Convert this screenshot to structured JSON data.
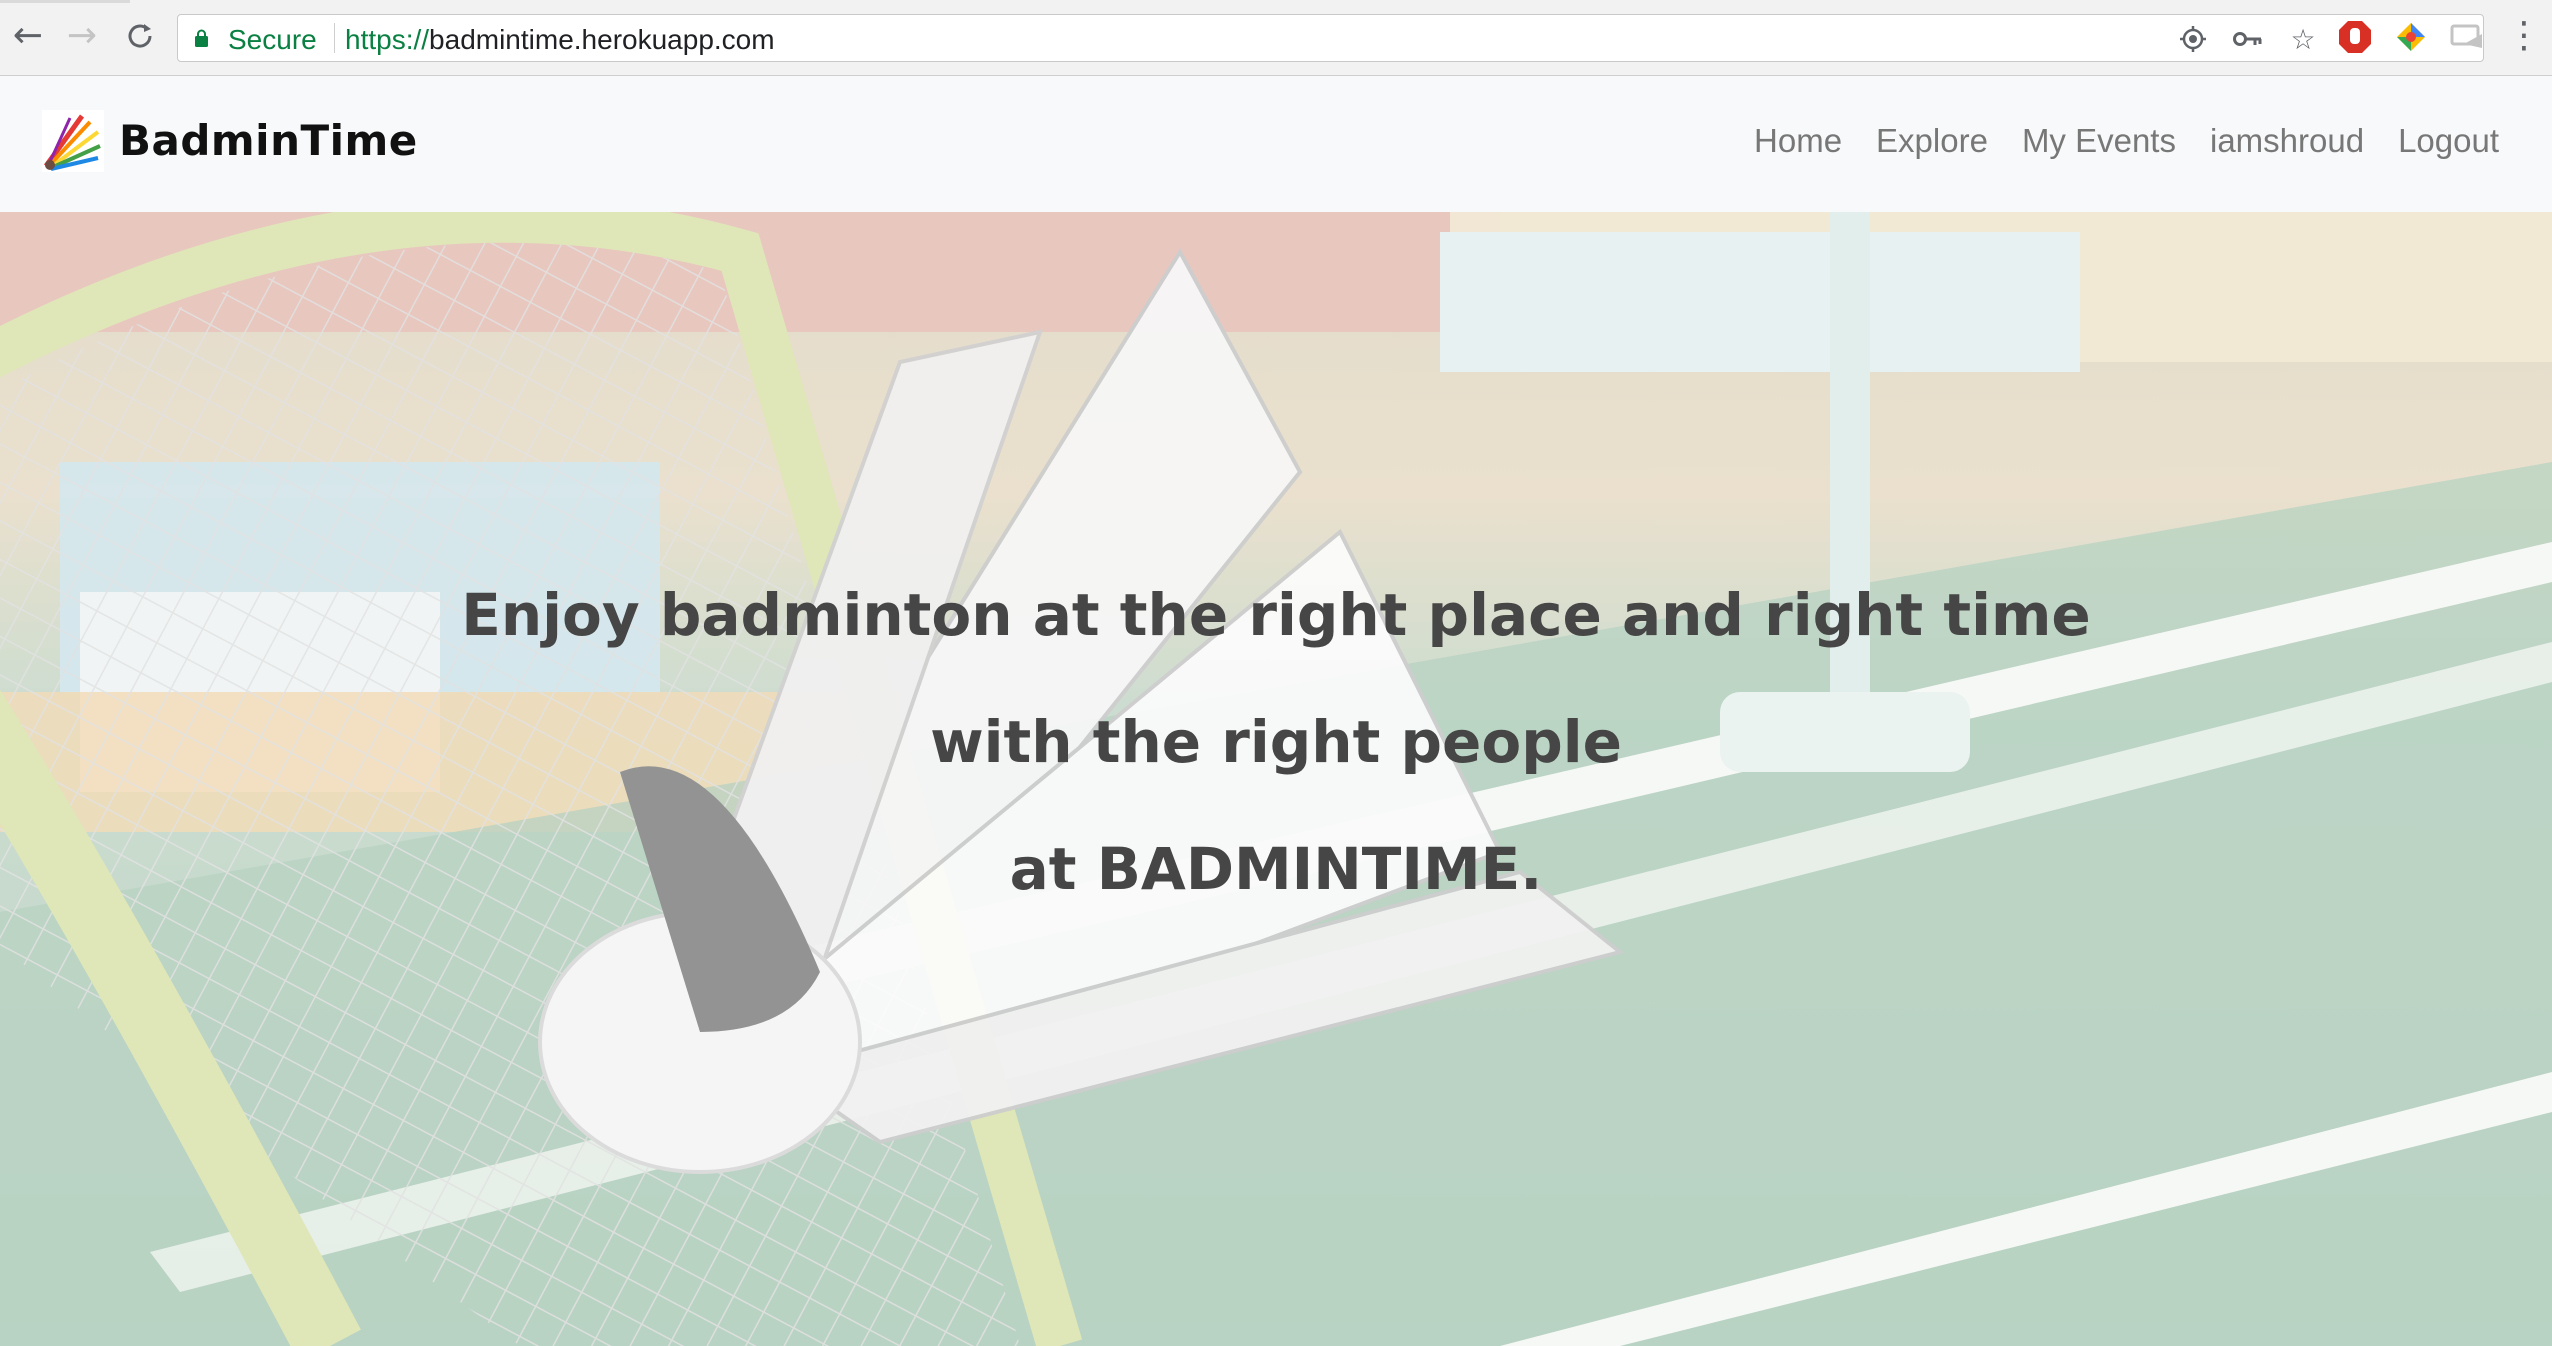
{
  "browser": {
    "secure_label": "Secure",
    "url_scheme": "https://",
    "url_host": "badmintime.herokuapp.com",
    "icons": [
      "back-arrow-icon",
      "forward-arrow-icon",
      "reload-icon",
      "lock-icon",
      "location-icon",
      "key-icon",
      "star-icon",
      "stop-extension-icon",
      "color-extension-icon",
      "cast-extension-icon",
      "more-menu-icon"
    ],
    "colors": {
      "secure_green": "#0b8043"
    }
  },
  "site": {
    "brand": "BadminTime",
    "nav": {
      "home": "Home",
      "explore": "Explore",
      "my_events": "My Events",
      "user": "iamshroud",
      "logout": "Logout"
    },
    "hero": {
      "line1": "Enjoy badminton at the right place and right time",
      "line2": "with the right people",
      "line3": "at BADMINTIME."
    },
    "colors": {
      "nav_bg": "#f8f9fa",
      "nav_link": "#777777",
      "hero_text": "#464646",
      "court_green": "#9fc3ad"
    }
  }
}
